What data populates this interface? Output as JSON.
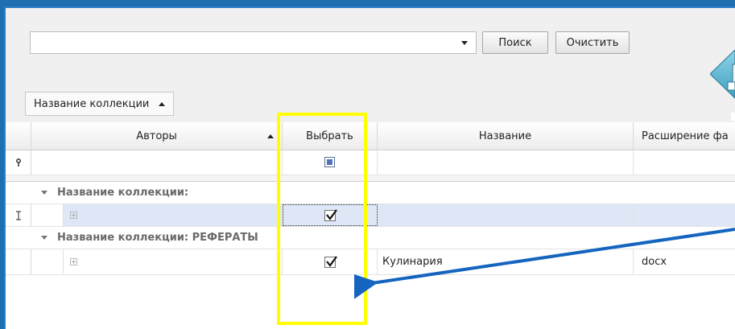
{
  "toolbar": {
    "search_value": "",
    "search_button": "Поиск",
    "clear_button": "Очистить"
  },
  "grouping": {
    "group_tag_label": "Название коллекции"
  },
  "grid": {
    "columns": [
      "Авторы",
      "Выбрать",
      "Название",
      "Расширение фа"
    ],
    "groups": [
      {
        "header": "Название коллекции:",
        "rows": [
          {
            "authors": "",
            "selected": true,
            "title": "",
            "extension": ""
          }
        ]
      },
      {
        "header": "Название коллекции: РЕФЕРАТЫ",
        "rows": [
          {
            "authors": "",
            "selected": true,
            "title": "Кулинария",
            "extension": "docx"
          }
        ]
      }
    ]
  },
  "annotation": {
    "highlight_color": "#ffff00",
    "arrow_color": "#1565c0"
  },
  "icons": {
    "filter_row": "filter-pin-icon",
    "cursor": "text-cursor-icon",
    "nav": "double-arrow-icon"
  }
}
